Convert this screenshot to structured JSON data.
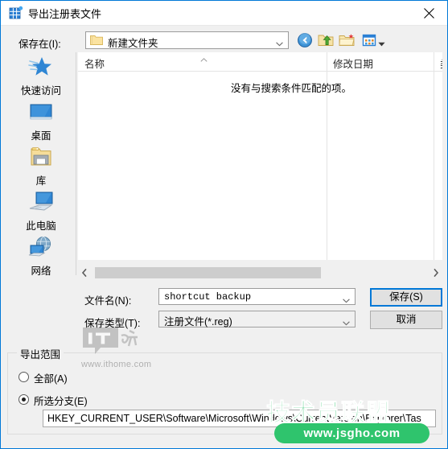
{
  "window": {
    "title": "导出注册表文件",
    "icon": "registry-icon",
    "close_label": "✕",
    "accent_color": "#0078d7",
    "background_color": "#f0f0f0"
  },
  "toolbar": {
    "save_in_label": "保存在(I):",
    "save_in_value": "新建文件夹",
    "buttons": [
      {
        "name": "back-button",
        "icon": "back-arrow-icon"
      },
      {
        "name": "up-one-level-button",
        "icon": "up-folder-icon"
      },
      {
        "name": "new-folder-button",
        "icon": "new-folder-icon"
      },
      {
        "name": "views-button",
        "icon": "view-grid-icon"
      }
    ]
  },
  "sidebar": {
    "items": [
      {
        "label": "快速访问",
        "icon": "quick-access-star-icon"
      },
      {
        "label": "桌面",
        "icon": "desktop-monitor-icon"
      },
      {
        "label": "库",
        "icon": "libraries-folder-icon"
      },
      {
        "label": "此电脑",
        "icon": "this-pc-computer-icon"
      },
      {
        "label": "网络",
        "icon": "network-globe-icon"
      }
    ]
  },
  "file_list": {
    "columns": [
      "名称",
      "修改日期",
      "类"
    ],
    "empty_message": "没有与搜索条件匹配的项。",
    "rows": []
  },
  "form": {
    "filename_label": "文件名(N):",
    "filename_value": "shortcut backup",
    "filetype_label": "保存类型(T):",
    "filetype_value": "注册文件(*.reg)",
    "save_button": "保存(S)",
    "cancel_button": "取消"
  },
  "export_range": {
    "group_title": "导出范围",
    "options": [
      {
        "label": "全部(A)",
        "accel": "A",
        "selected": false
      },
      {
        "label": "所选分支(E)",
        "accel": "E",
        "selected": true
      }
    ],
    "branch_value": "HKEY_CURRENT_USER\\Software\\Microsoft\\Windows\\CurrentVersion\\Explorer\\Tas"
  },
  "watermarks": {
    "ithome_url": "www.ithome.com",
    "jsgho_text": "技术员联盟",
    "jsgho_url": "www.jsgho.com",
    "jsgho_color": "#2fc46d"
  }
}
